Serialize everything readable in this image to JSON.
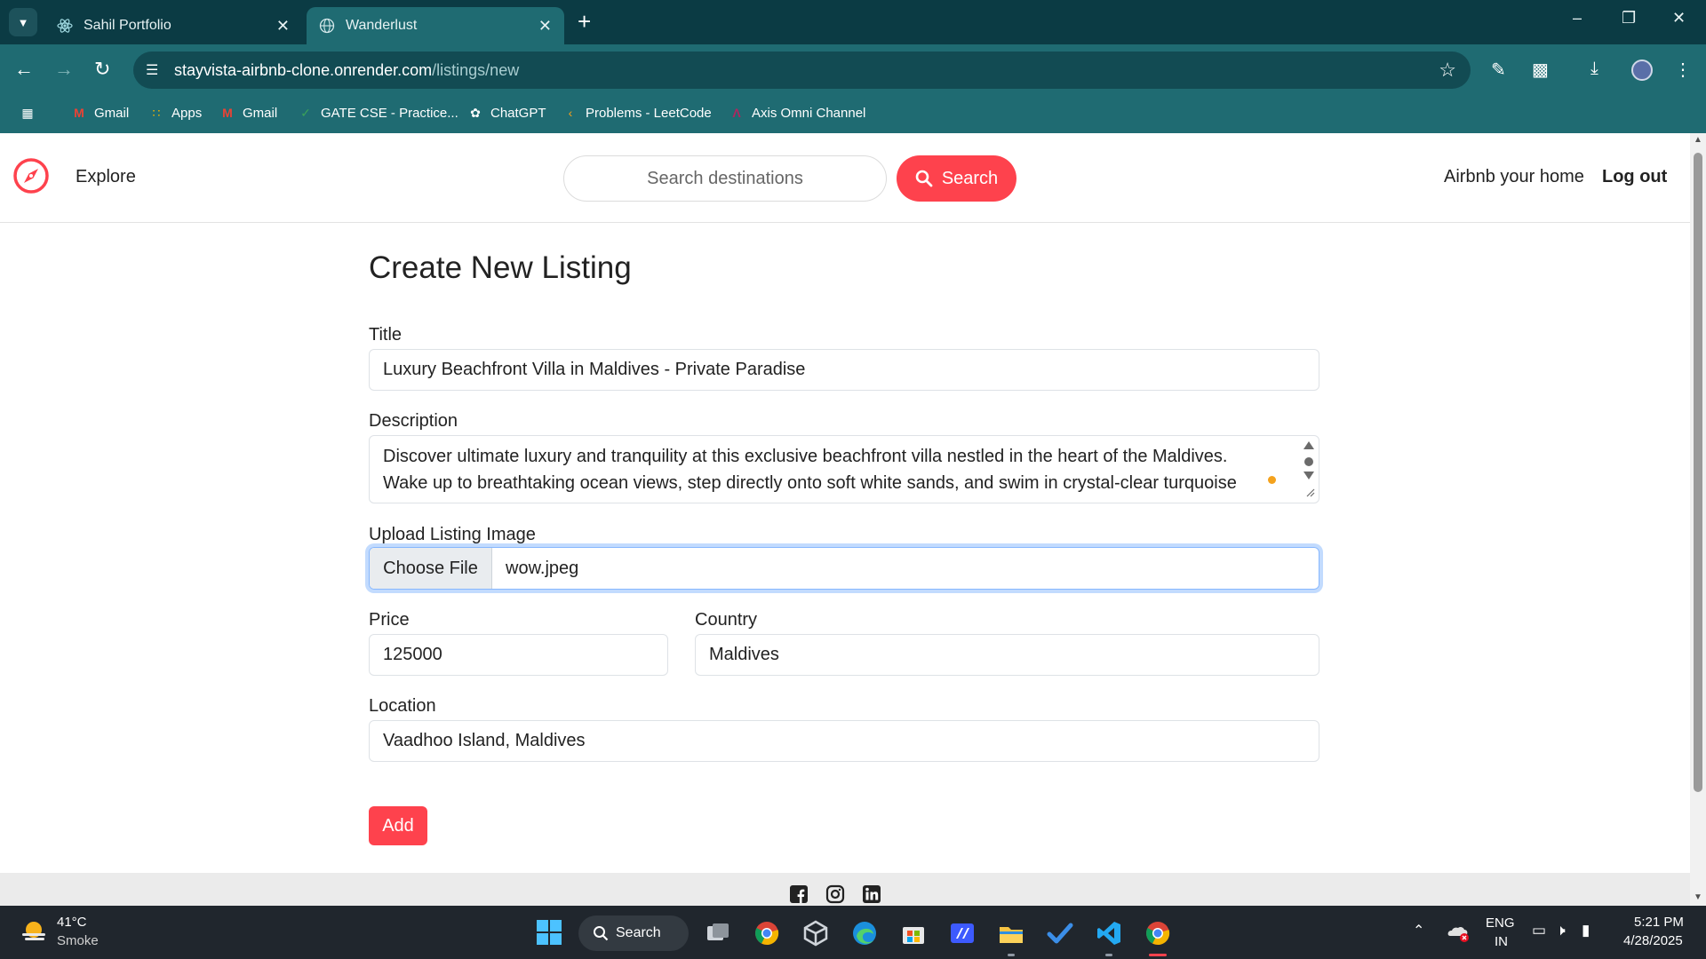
{
  "browser": {
    "tabs": [
      {
        "title": "Sahil Portfolio",
        "active": false
      },
      {
        "title": "Wanderlust",
        "active": true
      }
    ],
    "url_host": "stayvista-airbnb-clone.onrender.com",
    "url_path": "/listings/new",
    "bookmarks": [
      "Gmail",
      "Apps",
      "Gmail",
      "GATE CSE - Practice...",
      "ChatGPT",
      "Problems - LeetCode",
      "Axis Omni Channel"
    ]
  },
  "navbar": {
    "explore": "Explore",
    "search_placeholder": "Search destinations",
    "search_button": "Search",
    "host_link": "Airbnb your home",
    "logout": "Log out"
  },
  "form": {
    "heading": "Create New Listing",
    "title_label": "Title",
    "title_value": "Luxury Beachfront Villa in Maldives - Private Paradise",
    "description_label": "Description",
    "description_line1": "Discover ultimate luxury and tranquility at this exclusive beachfront villa nestled in the heart of the Maldives.",
    "description_line2": "Wake up to breathtaking ocean views, step directly onto soft white sands, and swim in crystal-clear turquoise",
    "image_label": "Upload Listing Image",
    "choose_file": "Choose File",
    "file_name": "wow.jpeg",
    "price_label": "Price",
    "price_value": "125000",
    "country_label": "Country",
    "country_value": "Maldives",
    "location_label": "Location",
    "location_value": "Vaadhoo Island, Maldives",
    "submit": "Add"
  },
  "taskbar": {
    "temperature": "41°C",
    "weather": "Smoke",
    "search": "Search",
    "lang_top": "ENG",
    "lang_bottom": "IN",
    "time": "5:21 PM",
    "date": "4/28/2025"
  },
  "colors": {
    "brand": "#fe424d",
    "chrome_dark": "#0b3b44",
    "chrome": "#1f6b72"
  }
}
